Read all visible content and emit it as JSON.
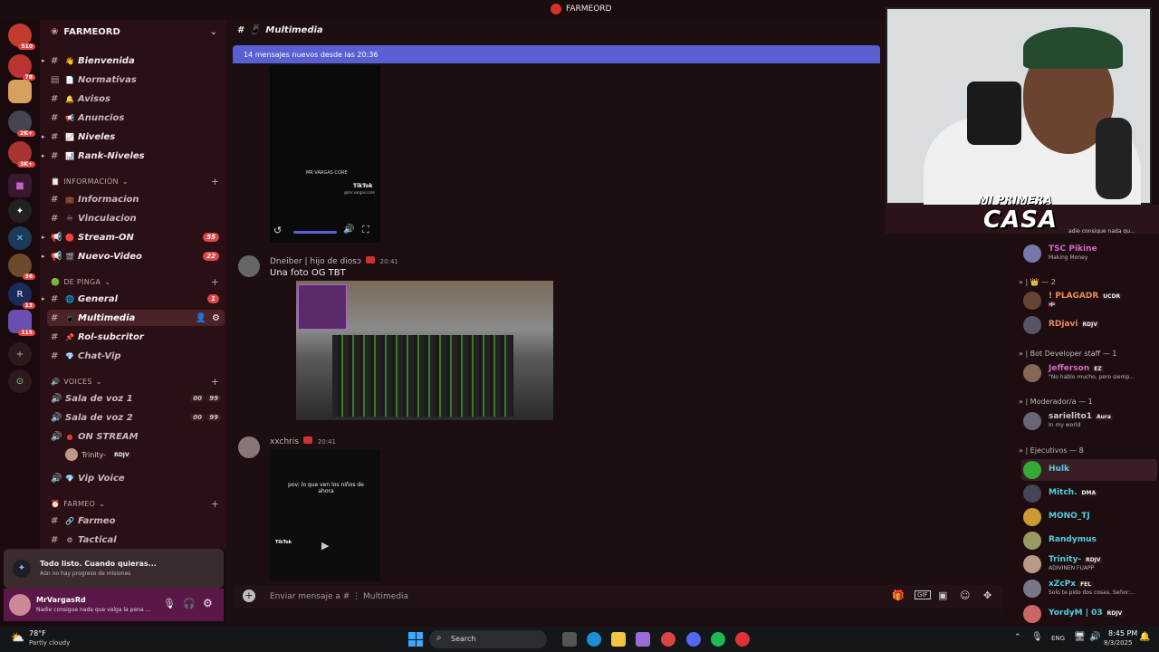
{
  "app": {
    "title": "FARMEORD"
  },
  "guilds": [
    {
      "badge": "510"
    },
    {
      "badge": "78"
    },
    {
      "badge": ""
    },
    {
      "badge": "2K+"
    },
    {
      "badge": "3K+"
    },
    {
      "badge": ""
    },
    {
      "badge": ""
    },
    {
      "badge": ""
    },
    {
      "badge": "36"
    },
    {
      "badge": "13"
    },
    {
      "badge": "115"
    }
  ],
  "server": {
    "name": "FARMEORD"
  },
  "channels": {
    "top": [
      {
        "name": "Bienvenida",
        "emoji": "👋"
      },
      {
        "name": "Normativas",
        "emoji": "📄"
      },
      {
        "name": "Avisos",
        "emoji": "🔔"
      },
      {
        "name": "Anuncios",
        "emoji": "📢"
      },
      {
        "name": "Niveles",
        "emoji": "📈"
      },
      {
        "name": "Rank-Niveles",
        "emoji": "📊"
      }
    ],
    "info_category": "INFORMACIÓN",
    "info": [
      {
        "name": "Informacion",
        "emoji": "💼"
      },
      {
        "name": "Vinculacion",
        "emoji": "♾"
      },
      {
        "name": "Stream-ON",
        "emoji": "🔴",
        "badge": "55"
      },
      {
        "name": "Nuevo-Video",
        "emoji": "🎬",
        "badge": "22"
      }
    ],
    "depinga_category": "DE PINGA",
    "depinga": [
      {
        "name": "General",
        "emoji": "🌐",
        "badge": "1"
      },
      {
        "name": "Multimedia",
        "emoji": "📱"
      },
      {
        "name": "Rol-subcritor",
        "emoji": "📌"
      },
      {
        "name": "Chat-Vip",
        "emoji": "💎"
      }
    ],
    "voices_category": "VOICES",
    "voices": [
      {
        "name": "Sala de voz 1",
        "a": "00",
        "b": "99"
      },
      {
        "name": "Sala de voz 2",
        "a": "00",
        "b": "99"
      },
      {
        "name": "ON STREAM"
      }
    ],
    "voice_user": {
      "name": "Trinity-",
      "tag": "RDJV"
    },
    "vip_voice": "Vip Voice",
    "farmeo_category": "FARMEO",
    "farmeo": [
      {
        "name": "Farmeo",
        "emoji": "🔗"
      },
      {
        "name": "Tactical",
        "emoji": "⚙"
      }
    ]
  },
  "quest": {
    "title": "Todo listo. Cuando quieras...",
    "subtitle": "Aún no hay progreso de misiones"
  },
  "user": {
    "name": "MrVargasRd",
    "status": "Nadie consigue nada que valga la pena ..."
  },
  "chat": {
    "channel": "Multimedia",
    "banner": "14 mensajes nuevos desde las 20:36",
    "tiktok1_caption": "MR VARGAS CORE",
    "tiktok1_brand": "TikTok",
    "tiktok1_handle": "@mr.vargas.core",
    "messages": [
      {
        "author": "Dneiber | hijo de diosↄ",
        "time": "20:41",
        "text": "Una foto OG TBT"
      },
      {
        "author": "xxchris",
        "time": "20:41",
        "text": ""
      }
    ],
    "tiktok2_caption": "pov: lo que ven los niños de ahora",
    "tiktok2_brand": "TikTok",
    "composer_placeholder": "Enviar mensaje a # ⋮ Multimedia"
  },
  "overlay": {
    "logo_line1": "MI PRIMERA",
    "logo_line2": "CASA",
    "ticker": "adie consigue nada qu..."
  },
  "members": {
    "first": {
      "name": "TSC Pikine",
      "status": "Making Money",
      "color": "#d46acb"
    },
    "sections": [
      {
        "label": "» | 👑 — 2"
      },
      {
        "label": "» | Bot Developer staff — 1"
      },
      {
        "label": "» | Moderador/a — 1"
      },
      {
        "label": "» | Ejecutivos — 8"
      }
    ],
    "list": [
      {
        "name": "! PLAGADR",
        "tag": "UCDR",
        "status": "🇩🇴",
        "color": "#e88d5a"
      },
      {
        "name": "RDjavi",
        "tag": "RDJV",
        "status": "",
        "color": "#e88d5a"
      },
      {
        "name": "Jefferson",
        "tag": "EZ",
        "status": "\"No hablo mucho, pero siemp...",
        "color": "#d46acb"
      },
      {
        "name": "sarielito1",
        "tag": "Aura",
        "status": "In my world",
        "color": "#c8c8d8"
      },
      {
        "name": "Hulk",
        "tag": "",
        "status": "",
        "color": "#4fd0e0"
      },
      {
        "name": "Mitch.",
        "tag": "DMA",
        "status": "",
        "color": "#4fd0e0"
      },
      {
        "name": "MONO_TJ",
        "tag": "",
        "status": "",
        "color": "#4fd0e0"
      },
      {
        "name": "Randymus",
        "tag": "",
        "status": "",
        "color": "#4fd0e0"
      },
      {
        "name": "Trinity-",
        "tag": "RDJV",
        "status": "ADIVINEN FUAPP",
        "color": "#4fd0e0"
      },
      {
        "name": "xZcPx",
        "tag": "FEL",
        "status": "Solo te pido dos cosas, Señor:...",
        "color": "#4fd0e0"
      },
      {
        "name": "YordyM | 03",
        "tag": "RDJV",
        "status": "",
        "color": "#4fd0e0"
      }
    ]
  },
  "taskbar": {
    "weather_temp": "78°F",
    "weather_desc": "Partly cloudy",
    "search": "Search",
    "lang": "ENG",
    "time": "8:45 PM",
    "date": "8/3/2025"
  },
  "colors": {
    "accent": "#5b5fd4",
    "sidebar": "#2a1014",
    "chat": "#1c0e11"
  }
}
